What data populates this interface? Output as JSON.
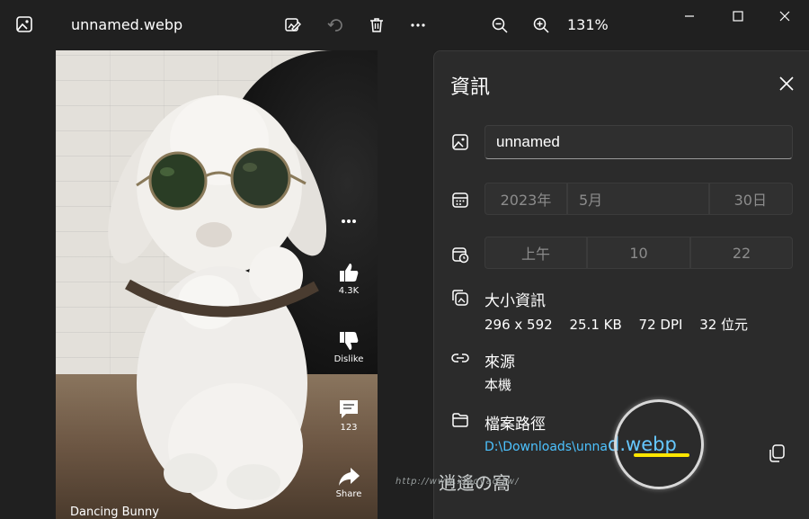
{
  "titlebar": {
    "file_name": "unnamed.webp",
    "zoom_level": "131%",
    "icons": {
      "app": "photos-app-icon",
      "edit": "edit-image-icon",
      "rotate": "rotate-icon",
      "delete": "delete-icon",
      "more": "more-options-icon",
      "zoom_out": "zoom-out-icon",
      "zoom_in": "zoom-in-icon",
      "minimize": "minimize-icon",
      "maximize": "maximize-icon",
      "close": "close-icon"
    }
  },
  "viewer": {
    "caption": "Dancing Bunny",
    "side_actions": [
      {
        "name": "more",
        "label": ""
      },
      {
        "name": "like",
        "label": "4.3K"
      },
      {
        "name": "dislike",
        "label": "Dislike"
      },
      {
        "name": "comments",
        "label": "123"
      },
      {
        "name": "share",
        "label": "Share"
      }
    ]
  },
  "info_panel": {
    "title": "資訊",
    "name_field": {
      "value": "unnamed"
    },
    "date": {
      "year": "2023年",
      "month": "5月",
      "day": "30日"
    },
    "time": {
      "period": "上午",
      "hour": "10",
      "minute": "22"
    },
    "size_info": {
      "label": "大小資訊",
      "dimensions": "296 x 592",
      "file_size": "25.1 KB",
      "dpi": "72 DPI",
      "bit_depth": "32 位元"
    },
    "source": {
      "label": "來源",
      "value": "本機"
    },
    "file_path": {
      "label": "檔案路徑",
      "path_prefix": "D:\\Downloads\\unna",
      "path_suffix": "d.webp"
    }
  },
  "watermark": {
    "logo_text": "逍遙の窩",
    "url": "http://www.xiaoyao.tw/"
  },
  "colors": {
    "background": "#202020",
    "panel": "#2b2b2b",
    "link": "#4cc2ff",
    "highlight_underline": "#ffe600"
  }
}
